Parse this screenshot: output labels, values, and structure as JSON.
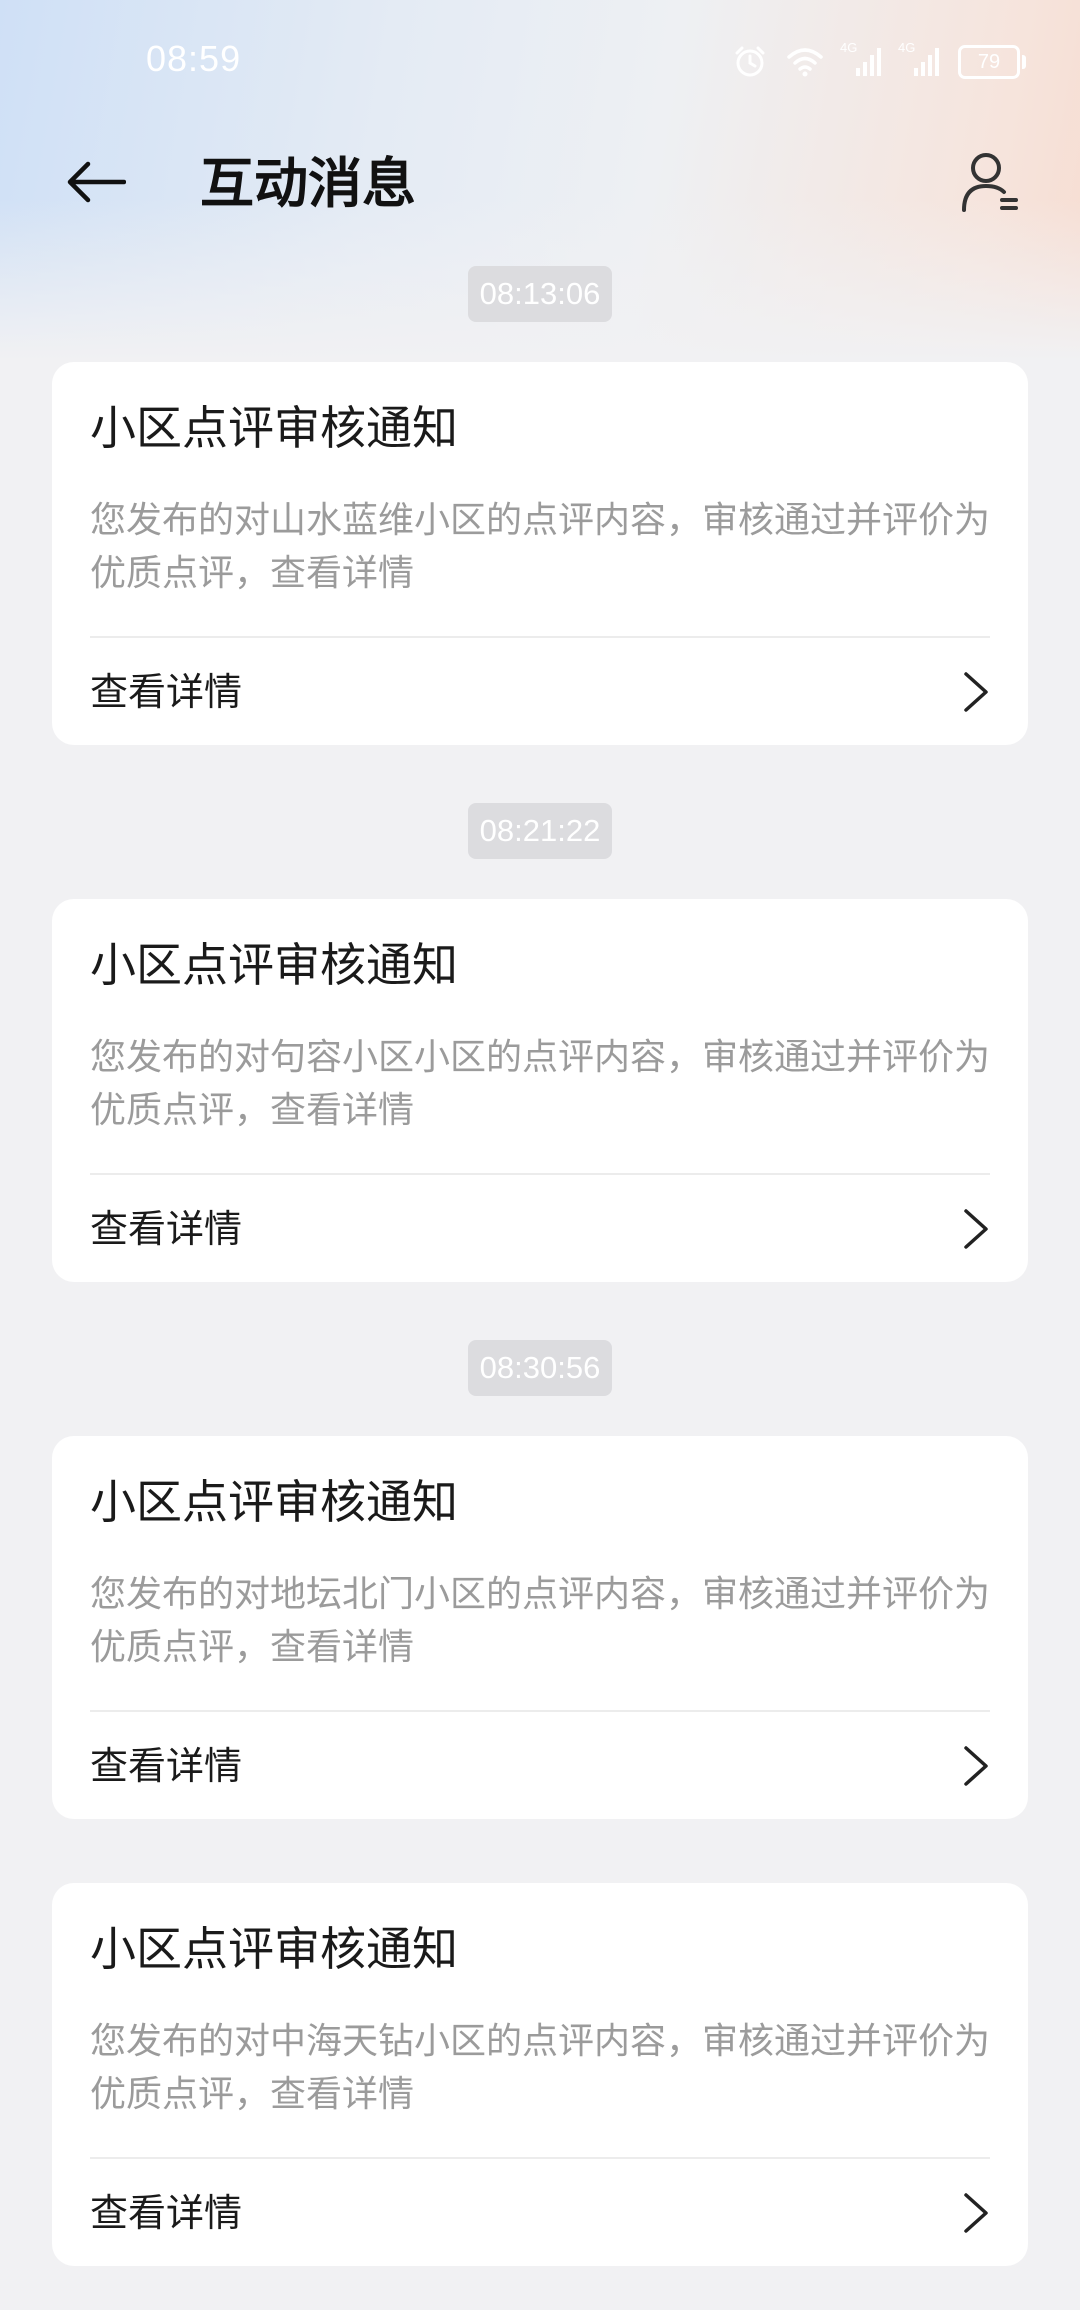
{
  "status_bar": {
    "time": "08:59",
    "battery": "79",
    "network_1": "4G",
    "network_2": "4G"
  },
  "header": {
    "title": "互动消息",
    "back_icon": "arrow-left-icon",
    "profile_icon": "user-settings-icon"
  },
  "messages": [
    {
      "time": "08:13:06",
      "title": "小区点评审核通知",
      "description": "您发布的对山水蓝维小区的点评内容，审核通过并评价为优质点评，查看详情",
      "action": "查看详情"
    },
    {
      "time": "08:21:22",
      "title": "小区点评审核通知",
      "description": "您发布的对句容小区小区的点评内容，审核通过并评价为优质点评，查看详情",
      "action": "查看详情"
    },
    {
      "time": "08:30:56",
      "title": "小区点评审核通知",
      "description": "您发布的对地坛北门小区的点评内容，审核通过并评价为优质点评，查看详情",
      "action": "查看详情"
    },
    {
      "title": "小区点评审核通知",
      "description": "您发布的对中海天钻小区的点评内容，审核通过并评价为优质点评，查看详情",
      "action": "查看详情"
    }
  ],
  "colors": {
    "background": "#f1f1f3",
    "card": "#ffffff",
    "chip": "#dcdcdf",
    "muted_text": "#9b9b9b",
    "primary_text": "#1a1a1a"
  }
}
